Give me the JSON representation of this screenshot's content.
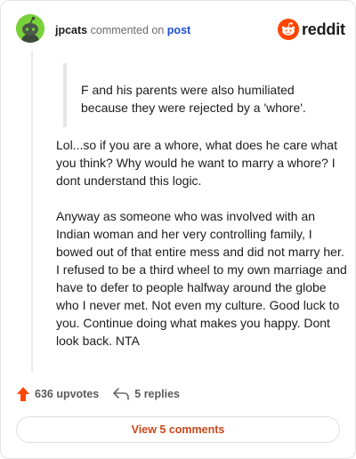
{
  "header": {
    "username": "jpcats",
    "action": "commented on",
    "post_link": "post"
  },
  "logo": {
    "text": "reddit",
    "icon": "reddit-snoo-icon",
    "color": "#ff4500"
  },
  "comment": {
    "quote": "F and his parents were also humiliated because they were rejected by a 'whore'.",
    "paragraphs": [
      "Lol...so if you are a whore, what does he care what you think? Why would he want to marry a whore? I dont understand this logic.",
      "Anyway as someone who was involved with an Indian woman and her very controlling family, I bowed out of that entire mess and did not marry her. I refused to be a third wheel to my own marriage and have to defer to people halfway around the globe who I never met. Not even my culture. Good luck to you. Continue doing what makes you happy. Dont look back. NTA"
    ]
  },
  "actions": {
    "upvotes": "636 upvotes",
    "replies": "5 replies",
    "upvote_icon": "upvote-arrow-icon",
    "reply_icon": "reply-arrow-icon",
    "upvote_color": "#ff4500"
  },
  "view_button": {
    "label": "View 5 comments",
    "color": "#c9481a"
  }
}
